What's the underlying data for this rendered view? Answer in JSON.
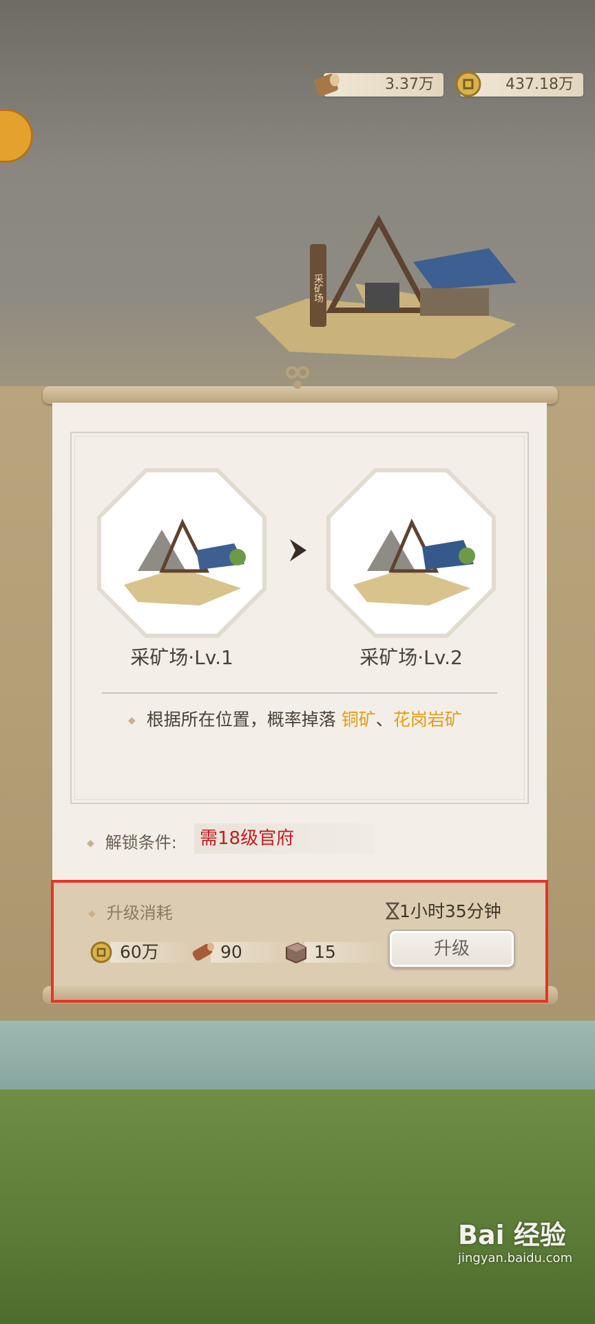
{
  "resources": {
    "wood": {
      "icon": "log-icon",
      "value": "3.37万"
    },
    "gold": {
      "icon": "coin-icon",
      "value": "437.18万"
    }
  },
  "map": {
    "signpost": "采矿场"
  },
  "dialog": {
    "current": {
      "name": "采矿场·Lv.1"
    },
    "next": {
      "name": "采矿场·Lv.2"
    },
    "description": {
      "prefix": "根据所在位置，概率掉落 ",
      "ore1": "铜矿",
      "sep": "、",
      "ore2": "花岗岩矿"
    },
    "unlock": {
      "label": "解锁条件:",
      "value": "需18级官府"
    },
    "cost": {
      "title": "升级消耗",
      "duration": "1小时35分钟",
      "gold": "60万",
      "wood": "90",
      "stone": "15",
      "button": "升级"
    }
  },
  "watermark": {
    "logo": "Bai 经验",
    "url": "jingyan.baidu.com"
  },
  "colors": {
    "accent_orange": "#e59a1a",
    "warning_red": "#c51b1b",
    "highlight_border": "#e8322a"
  }
}
